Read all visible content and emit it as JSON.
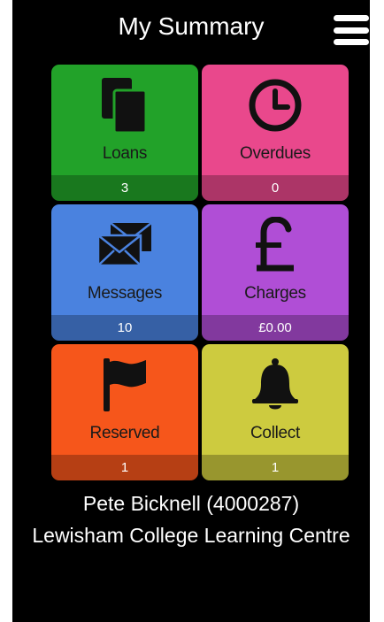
{
  "header": {
    "title": "My Summary",
    "menu_icon": "hamburger-menu-icon"
  },
  "tiles": [
    {
      "label": "Loans",
      "count": "3",
      "color": "#22a229",
      "icon": "documents-icon"
    },
    {
      "label": "Overdues",
      "count": "0",
      "color": "#e9488c",
      "icon": "clock-icon"
    },
    {
      "label": "Messages",
      "count": "10",
      "color": "#4a82df",
      "icon": "envelopes-icon"
    },
    {
      "label": "Charges",
      "count": "£0.00",
      "color": "#b04ed6",
      "icon": "pound-sign-icon"
    },
    {
      "label": "Reserved",
      "count": "1",
      "color": "#f6561b",
      "icon": "flag-icon"
    },
    {
      "label": "Collect",
      "count": "1",
      "color": "#cdcb3f",
      "icon": "bell-icon"
    }
  ],
  "footer": {
    "user": "Pete Bicknell (4000287)",
    "organisation": "Lewisham College Learning Centre"
  }
}
